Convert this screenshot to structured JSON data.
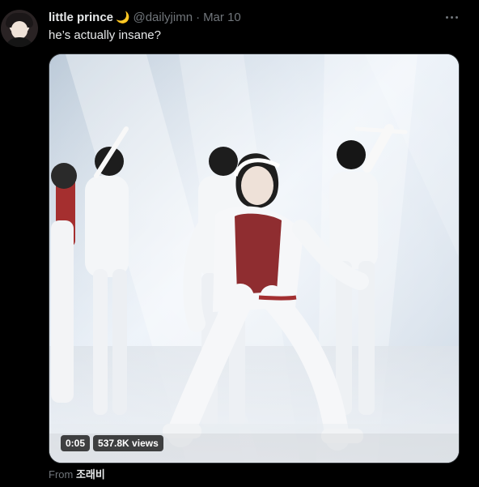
{
  "post": {
    "display_name": "little prince",
    "name_emoji": "🌙",
    "handle": "@dailyjimn",
    "separator": "·",
    "date": "Mar 10",
    "text": "he’s actually insane?",
    "more_icon": "more-horizontal-icon"
  },
  "media": {
    "duration": "0:05",
    "views": "537.8K views"
  },
  "source": {
    "from_label": "From",
    "from_value": "조래비"
  }
}
